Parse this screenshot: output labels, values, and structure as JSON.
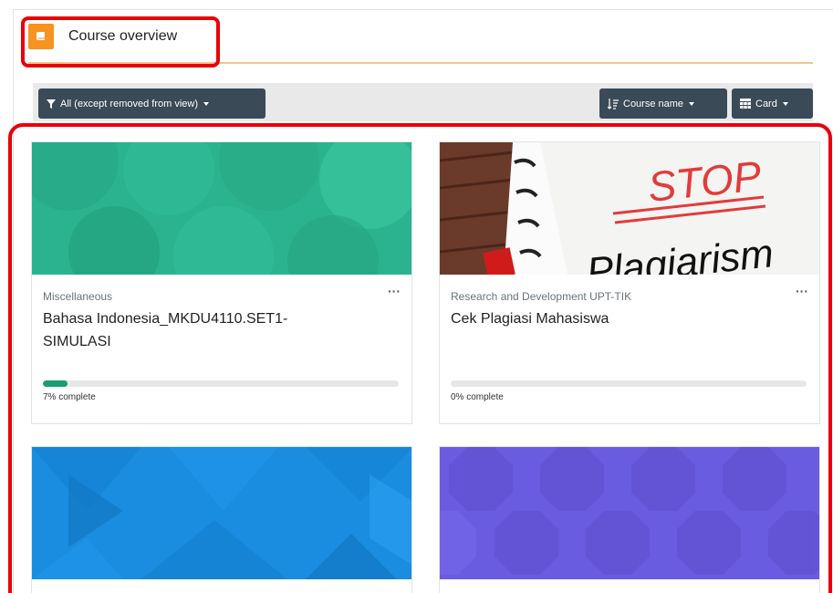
{
  "block": {
    "title": "Course overview",
    "icon": "book-icon",
    "accent": "#f7931e"
  },
  "toolbar": {
    "filter_label": "All (except removed from view)",
    "sort_label": "Course name",
    "view_label": "Card",
    "button_color": "#3a4a57"
  },
  "courses": [
    {
      "category": "Miscellaneous",
      "name": "Bahasa Indonesia_MKDU4110.SET1-SIMULASI",
      "progress_percent": 7,
      "progress_text": "7% complete",
      "image_color": "#2bb38f"
    },
    {
      "category": "Research and Development UPT-TIK",
      "name": "Cek Plagiasi Mahasiswa",
      "progress_percent": 0,
      "progress_text": "0% complete",
      "image_text_1": "STOP",
      "image_text_2": "Plagiarism"
    },
    {
      "image_color": "#1a8de0"
    },
    {
      "image_color": "#6a5ce0"
    }
  ],
  "more_icon": "ellipsis-icon",
  "highlight_color": "#e8000b"
}
